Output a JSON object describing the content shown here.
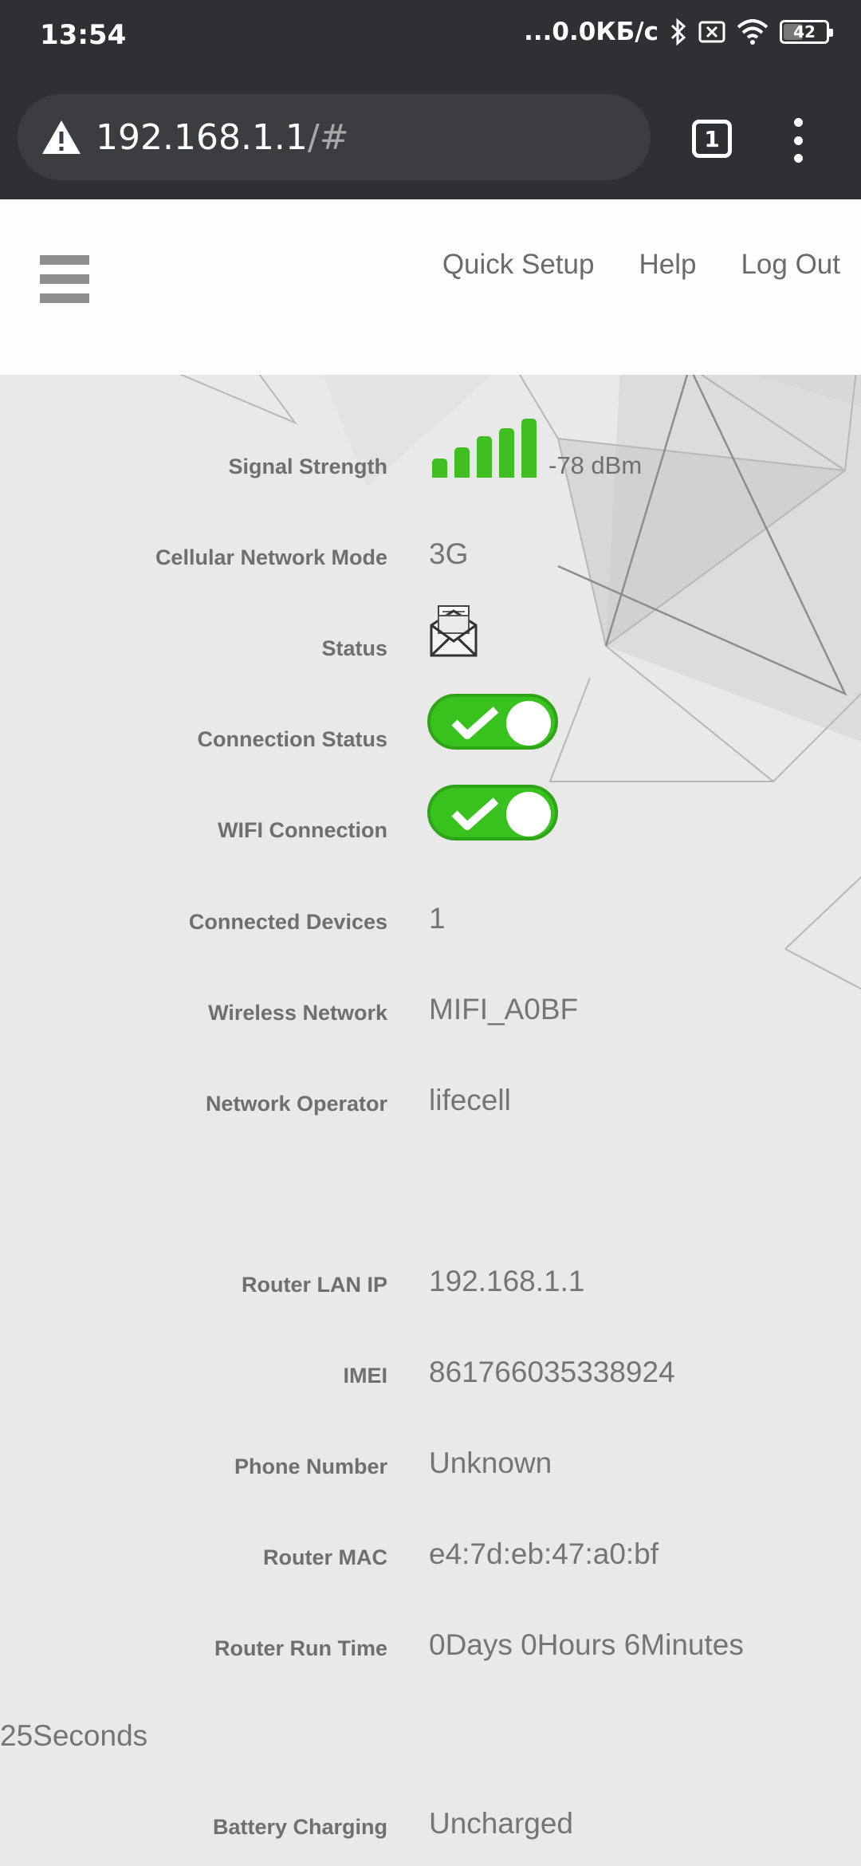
{
  "status_bar": {
    "time": "13:54",
    "network_speed": "...0.0КБ/с",
    "battery_level": "42",
    "icons": [
      "bluetooth-icon",
      "sim-off-icon",
      "wifi-icon",
      "battery-icon"
    ]
  },
  "browser": {
    "url_host": "192.168.1.1",
    "url_path": "/#",
    "tab_count": "1",
    "icons": [
      "warning-icon",
      "tabs-icon",
      "overflow-menu-icon"
    ]
  },
  "header": {
    "nav": [
      "Quick Setup",
      "Help",
      "Log Out"
    ]
  },
  "info": {
    "signal_strength": {
      "label": "Signal Strength",
      "value": "-78 dBm",
      "bars": 5,
      "bar_color": "#3fbf22"
    },
    "cellular_mode": {
      "label": "Cellular Network Mode",
      "value": "3G"
    },
    "status": {
      "label": "Status",
      "icon": "envelope-icon"
    },
    "connection_status": {
      "label": "Connection Status",
      "on": true
    },
    "wifi_connection": {
      "label": "WIFI Connection",
      "on": true
    },
    "connected_devices": {
      "label": "Connected Devices",
      "value": "1"
    },
    "wireless_network": {
      "label": "Wireless Network",
      "value": "MIFI_A0BF"
    },
    "network_operator": {
      "label": "Network Operator",
      "value": "lifecell"
    },
    "router_lan_ip": {
      "label": "Router LAN IP",
      "value": "192.168.1.1"
    },
    "imei": {
      "label": "IMEI",
      "value": "861766035338924"
    },
    "phone_number": {
      "label": "Phone Number",
      "value": "Unknown"
    },
    "router_mac": {
      "label": "Router MAC",
      "value": "e4:7d:eb:47:a0:bf"
    },
    "router_run_time": {
      "label": "Router Run Time",
      "value": "0Days 0Hours 6Minutes",
      "value_wrap": "25Seconds"
    },
    "battery_charging": {
      "label": "Battery Charging",
      "value": "Uncharged"
    }
  },
  "colors": {
    "toggle_on": "#38c21e",
    "chrome_dark": "#2f3034"
  }
}
